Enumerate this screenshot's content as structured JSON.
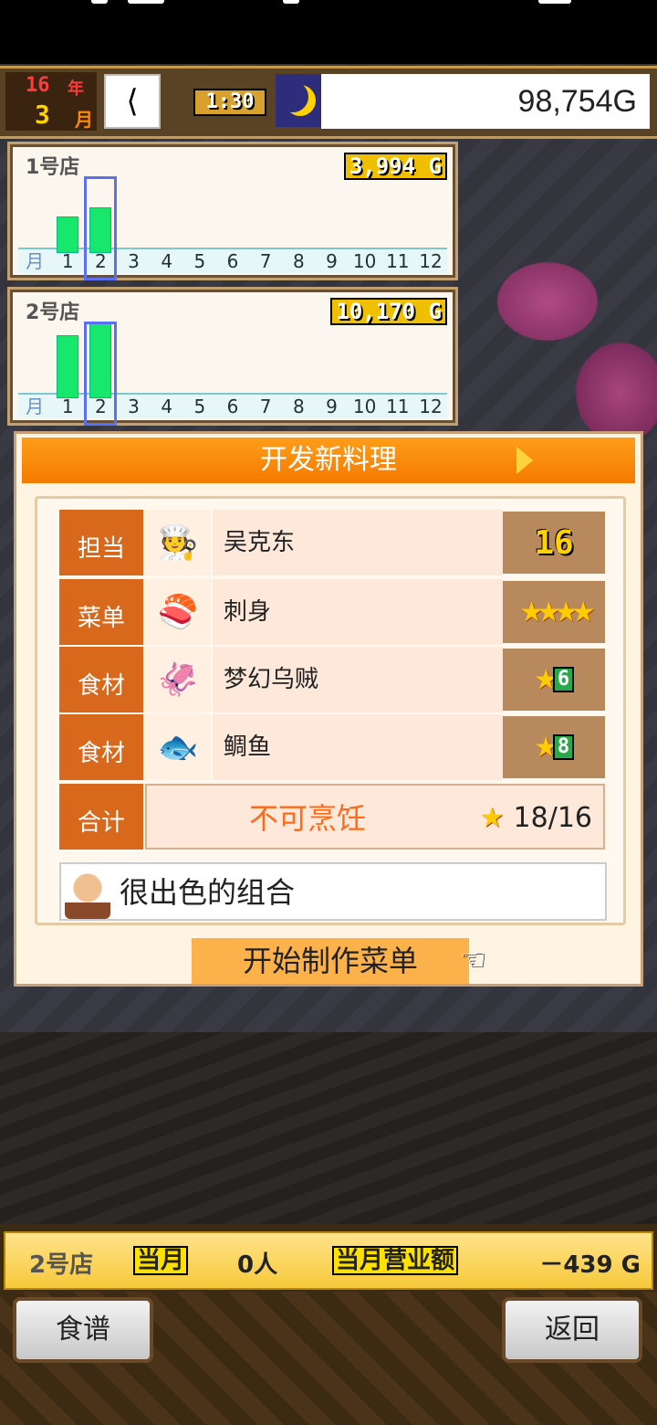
{
  "hud": {
    "year_num": "16",
    "year_unit": "年",
    "month_num": "3",
    "month_unit": "月",
    "time": "1:30",
    "money": "98,754G"
  },
  "stores": [
    {
      "name": "1号店",
      "sales": "3,994 G",
      "month_label": "月",
      "months": [
        "1",
        "2",
        "3",
        "4",
        "5",
        "6",
        "7",
        "8",
        "9",
        "10",
        "11",
        "12"
      ],
      "selected_month": "2",
      "bar_values": [
        0.47,
        0.58
      ]
    },
    {
      "name": "2号店",
      "sales": "10,170 G",
      "month_label": "月",
      "months": [
        "1",
        "2",
        "3",
        "4",
        "5",
        "6",
        "7",
        "8",
        "9",
        "10",
        "11",
        "12"
      ],
      "selected_month": "2",
      "bar_values": [
        0.8,
        0.95
      ]
    }
  ],
  "dialog": {
    "title": "开发新料理",
    "rows": [
      {
        "label": "担当",
        "icon": "chef-portrait-icon",
        "value": "吴克东",
        "right": "16"
      },
      {
        "label": "菜单",
        "icon": "sashimi-dish-icon",
        "value": "刺身",
        "right": "★★★★"
      },
      {
        "label": "食材",
        "icon": "squid-icon",
        "value": "梦幻乌贼",
        "right_star": "★",
        "right": "6"
      },
      {
        "label": "食材",
        "icon": "sea-bream-icon",
        "value": "鲷鱼",
        "right_star": "★",
        "right": "8"
      }
    ],
    "total": {
      "label": "合计",
      "status": "不可烹饪",
      "star": "★",
      "score": "18/16"
    },
    "comment": "很出色的组合",
    "start_button": "开始制作菜单"
  },
  "bottom": {
    "store": "2号店",
    "this_month": "当月",
    "customers": "0人",
    "revenue_label": "当月营业额",
    "revenue": "－439 G",
    "recipe_button": "食谱",
    "back_button": "返回"
  },
  "colors": {
    "accent_orange": "#f47a00",
    "label_orange": "#d8681b",
    "bar_green": "#17e86c",
    "select_blue": "#5a70f0"
  }
}
